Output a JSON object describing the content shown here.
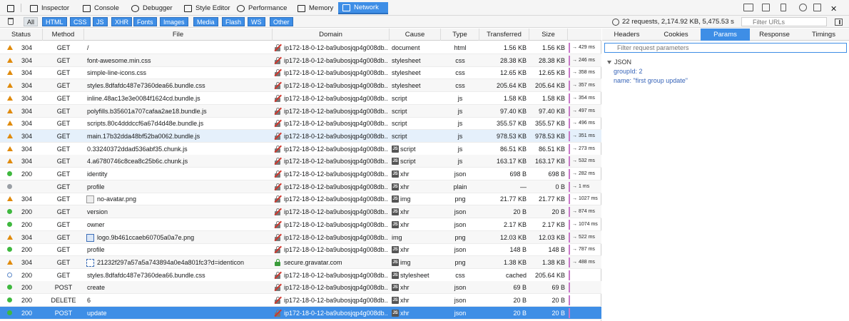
{
  "toolbar": {
    "tools": [
      {
        "label": "Inspector",
        "icon": "inspector-icon"
      },
      {
        "label": "Console",
        "icon": "console-icon"
      },
      {
        "label": "Debugger",
        "icon": "debugger-icon"
      },
      {
        "label": "Style Editor",
        "icon": "style-editor-icon"
      },
      {
        "label": "Performance",
        "icon": "performance-icon"
      },
      {
        "label": "Memory",
        "icon": "memory-icon"
      },
      {
        "label": "Network",
        "icon": "network-icon",
        "active": true
      }
    ]
  },
  "filter": {
    "types": [
      "All",
      "HTML",
      "CSS",
      "JS",
      "XHR",
      "Fonts",
      "Images",
      "Media",
      "Flash",
      "WS",
      "Other"
    ],
    "summary": "22 requests, 2,174.92 KB, 5,475.53 s",
    "url_placeholder": "Filter URLs"
  },
  "columns": [
    "Status",
    "Method",
    "File",
    "Domain",
    "Cause",
    "Type",
    "Transferred",
    "Size"
  ],
  "requests": [
    {
      "ind": "tri",
      "status": "304",
      "method": "GET",
      "file": "/",
      "domain": "ip172-18-0-12-ba9ubosjqp4g008db...",
      "secure": false,
      "js": false,
      "cause": "document",
      "type": "html",
      "transferred": "1.56 KB",
      "size": "1.56 KB",
      "time": "→ 429 ms"
    },
    {
      "ind": "tri",
      "status": "304",
      "method": "GET",
      "file": "font-awesome.min.css",
      "domain": "ip172-18-0-12-ba9ubosjqp4g008db...",
      "secure": false,
      "js": false,
      "cause": "stylesheet",
      "type": "css",
      "transferred": "28.38 KB",
      "size": "28.38 KB",
      "time": "→ 246 ms"
    },
    {
      "ind": "tri",
      "status": "304",
      "method": "GET",
      "file": "simple-line-icons.css",
      "domain": "ip172-18-0-12-ba9ubosjqp4g008db...",
      "secure": false,
      "js": false,
      "cause": "stylesheet",
      "type": "css",
      "transferred": "12.65 KB",
      "size": "12.65 KB",
      "time": "→ 358 ms"
    },
    {
      "ind": "tri",
      "status": "304",
      "method": "GET",
      "file": "styles.8dfafdc487e7360dea66.bundle.css",
      "domain": "ip172-18-0-12-ba9ubosjqp4g008db...",
      "secure": false,
      "js": false,
      "cause": "stylesheet",
      "type": "css",
      "transferred": "205.64 KB",
      "size": "205.64 KB",
      "time": "→ 357 ms"
    },
    {
      "ind": "tri",
      "status": "304",
      "method": "GET",
      "file": "inline.48ac13e3e0084f1624cd.bundle.js",
      "domain": "ip172-18-0-12-ba9ubosjqp4g008db...",
      "secure": false,
      "js": false,
      "cause": "script",
      "type": "js",
      "transferred": "1.58 KB",
      "size": "1.58 KB",
      "time": "→ 354 ms"
    },
    {
      "ind": "tri",
      "status": "304",
      "method": "GET",
      "file": "polyfills.b35601a707cafaa2ae18.bundle.js",
      "domain": "ip172-18-0-12-ba9ubosjqp4g008db...",
      "secure": false,
      "js": false,
      "cause": "script",
      "type": "js",
      "transferred": "97.40 KB",
      "size": "97.40 KB",
      "time": "→ 497 ms"
    },
    {
      "ind": "tri",
      "status": "304",
      "method": "GET",
      "file": "scripts.80c4dddccf6a67d4d48e.bundle.js",
      "domain": "ip172-18-0-12-ba9ubosjqp4g008db...",
      "secure": false,
      "js": false,
      "cause": "script",
      "type": "js",
      "transferred": "355.57 KB",
      "size": "355.57 KB",
      "time": "→ 496 ms"
    },
    {
      "ind": "tri",
      "status": "304",
      "method": "GET",
      "file": "main.17b32dda48bf52ba0062.bundle.js",
      "domain": "ip172-18-0-12-ba9ubosjqp4g008db...",
      "secure": false,
      "js": false,
      "cause": "script",
      "type": "js",
      "transferred": "978.53 KB",
      "size": "978.53 KB",
      "time": "→ 351 ms"
    },
    {
      "ind": "tri",
      "status": "304",
      "method": "GET",
      "file": "0.33240372ddad536abf35.chunk.js",
      "domain": "ip172-18-0-12-ba9ubosjqp4g008db...",
      "secure": false,
      "js": true,
      "cause": "script",
      "type": "js",
      "transferred": "86.51 KB",
      "size": "86.51 KB",
      "time": "→ 273 ms"
    },
    {
      "ind": "tri",
      "status": "304",
      "method": "GET",
      "file": "4.a6780746c8cea8c25b6c.chunk.js",
      "domain": "ip172-18-0-12-ba9ubosjqp4g008db...",
      "secure": false,
      "js": true,
      "cause": "script",
      "type": "js",
      "transferred": "163.17 KB",
      "size": "163.17 KB",
      "time": "→ 532 ms"
    },
    {
      "ind": "dot",
      "status": "200",
      "method": "GET",
      "file": "identity",
      "domain": "ip172-18-0-12-ba9ubosjqp4g008db...",
      "secure": false,
      "js": true,
      "cause": "xhr",
      "type": "json",
      "transferred": "698 B",
      "size": "698 B",
      "time": "→ 282 ms"
    },
    {
      "ind": "gray",
      "status": "",
      "method": "GET",
      "file": "profile",
      "domain": "ip172-18-0-12-ba9ubosjqp4g008db...",
      "secure": false,
      "js": true,
      "cause": "xhr",
      "type": "plain",
      "transferred": "—",
      "size": "0 B",
      "time": "→ 1 ms"
    },
    {
      "ind": "tri",
      "status": "304",
      "method": "GET",
      "file": "no-avatar.png",
      "thumb": "plain",
      "domain": "ip172-18-0-12-ba9ubosjqp4g008db...",
      "secure": false,
      "js": true,
      "cause": "img",
      "type": "png",
      "transferred": "21.77 KB",
      "size": "21.77 KB",
      "time": "→ 1027 ms"
    },
    {
      "ind": "dot",
      "status": "200",
      "method": "GET",
      "file": "version",
      "domain": "ip172-18-0-12-ba9ubosjqp4g008db...",
      "secure": false,
      "js": true,
      "cause": "xhr",
      "type": "json",
      "transferred": "20 B",
      "size": "20 B",
      "time": "→ 874 ms"
    },
    {
      "ind": "dot",
      "status": "200",
      "method": "GET",
      "file": "owner",
      "domain": "ip172-18-0-12-ba9ubosjqp4g008db...",
      "secure": false,
      "js": true,
      "cause": "xhr",
      "type": "json",
      "transferred": "2.17 KB",
      "size": "2.17 KB",
      "time": "→ 1074 ms"
    },
    {
      "ind": "tri",
      "status": "304",
      "method": "GET",
      "file": "logo.9b461ccaeb60705a0a7e.png",
      "thumb": "logo",
      "domain": "ip172-18-0-12-ba9ubosjqp4g008db...",
      "secure": false,
      "js": false,
      "cause": "img",
      "type": "png",
      "transferred": "12.03 KB",
      "size": "12.03 KB",
      "time": "→ 522 ms"
    },
    {
      "ind": "dot",
      "status": "200",
      "method": "GET",
      "file": "profile",
      "domain": "ip172-18-0-12-ba9ubosjqp4g008db...",
      "secure": false,
      "js": true,
      "cause": "xhr",
      "type": "json",
      "transferred": "148 B",
      "size": "148 B",
      "time": "→ 787 ms"
    },
    {
      "ind": "tri",
      "status": "304",
      "method": "GET",
      "file": "21232f297a57a5a743894a0e4a801fc3?d=identicon",
      "thumb": "identicon",
      "domain": "secure.gravatar.com",
      "secure": true,
      "js": true,
      "cause": "img",
      "type": "png",
      "transferred": "1.38 KB",
      "size": "1.38 KB",
      "time": "→ 488 ms"
    },
    {
      "ind": "hollow",
      "status": "200",
      "method": "GET",
      "file": "styles.8dfafdc487e7360dea66.bundle.css",
      "domain": "ip172-18-0-12-ba9ubosjqp4g008db...",
      "secure": false,
      "js": true,
      "cause": "stylesheet",
      "type": "css",
      "transferred": "cached",
      "size": "205.64 KB",
      "time": ""
    },
    {
      "ind": "dot",
      "status": "200",
      "method": "POST",
      "file": "create",
      "domain": "ip172-18-0-12-ba9ubosjqp4g008db...",
      "secure": false,
      "js": true,
      "cause": "xhr",
      "type": "json",
      "transferred": "69 B",
      "size": "69 B",
      "time": ""
    },
    {
      "ind": "dot",
      "status": "200",
      "method": "DELETE",
      "file": "6",
      "domain": "ip172-18-0-12-ba9ubosjqp4g008db...",
      "secure": false,
      "js": true,
      "cause": "xhr",
      "type": "json",
      "transferred": "20 B",
      "size": "20 B",
      "time": ""
    },
    {
      "ind": "dot",
      "status": "200",
      "method": "POST",
      "file": "update",
      "domain": "ip172-18-0-12-ba9ubosjqp4g008db...",
      "secure": false,
      "js": true,
      "cause": "xhr",
      "type": "json",
      "transferred": "20 B",
      "size": "20 B",
      "time": "",
      "selected": true
    }
  ],
  "panel": {
    "tabs": [
      "Headers",
      "Cookies",
      "Params",
      "Response",
      "Timings"
    ],
    "active_tab": "Params",
    "filter_placeholder": "Filter request parameters",
    "section_title": "JSON",
    "params": [
      {
        "key": "groupId",
        "value": "2",
        "kind": "num"
      },
      {
        "key": "name",
        "value": "\"first group update\"",
        "kind": "str"
      }
    ]
  },
  "colors": {
    "accent": "#3e8ee6",
    "warning": "#e08a0b",
    "success": "#3fb83f",
    "waterfall": "#c878c8"
  }
}
